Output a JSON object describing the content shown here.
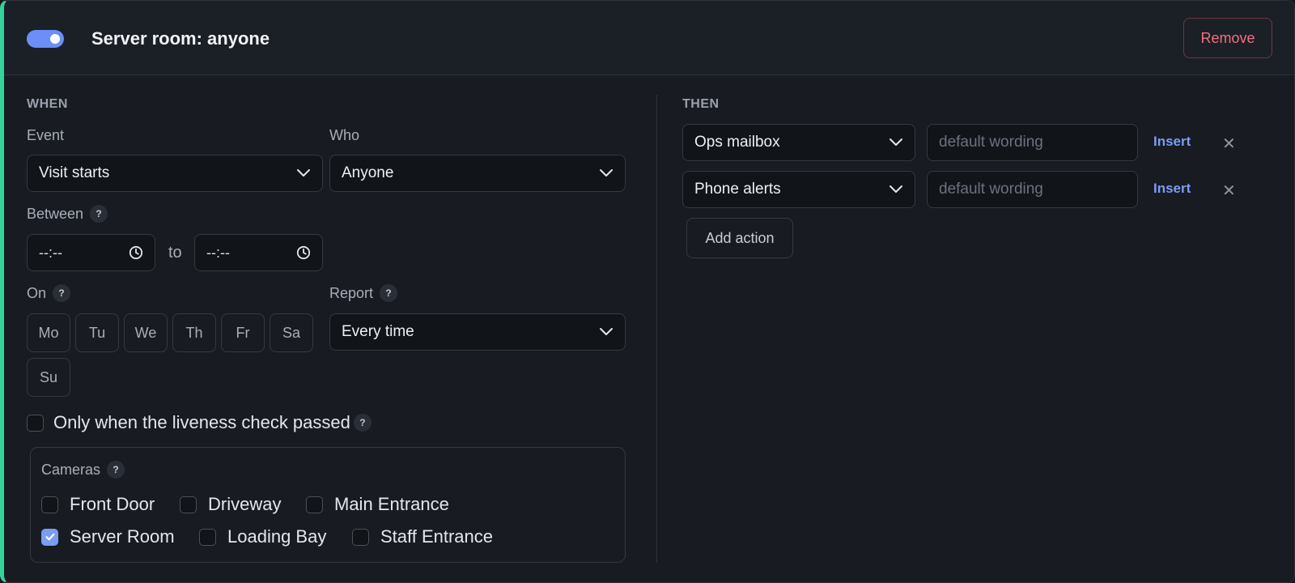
{
  "header": {
    "title": "Server room: anyone",
    "enabled": true,
    "remove_label": "Remove"
  },
  "when": {
    "section_label": "WHEN",
    "event": {
      "label": "Event",
      "value": "Visit starts"
    },
    "who": {
      "label": "Who",
      "value": "Anyone"
    },
    "between": {
      "label": "Between",
      "help": "?",
      "start": "--:--",
      "to": "to",
      "end": "--:--"
    },
    "on": {
      "label": "On",
      "help": "?",
      "days": [
        "Mo",
        "Tu",
        "We",
        "Th",
        "Fr",
        "Sa",
        "Su"
      ]
    },
    "report": {
      "label": "Report",
      "help": "?",
      "value": "Every time"
    },
    "liveness": {
      "label": "Only when the liveness check passed",
      "help": "?",
      "checked": false
    },
    "cameras": {
      "label": "Cameras",
      "help": "?",
      "items": [
        {
          "name": "Front Door",
          "checked": false
        },
        {
          "name": "Driveway",
          "checked": false
        },
        {
          "name": "Main Entrance",
          "checked": false
        },
        {
          "name": "Server Room",
          "checked": true
        },
        {
          "name": "Loading Bay",
          "checked": false
        },
        {
          "name": "Staff Entrance",
          "checked": false
        }
      ]
    }
  },
  "then": {
    "section_label": "THEN",
    "actions": [
      {
        "target": "Ops mailbox",
        "wording_placeholder": "default wording",
        "insert_label": "Insert",
        "remove_glyph": "✕"
      },
      {
        "target": "Phone alerts",
        "wording_placeholder": "default wording",
        "insert_label": "Insert",
        "remove_glyph": "✕"
      }
    ],
    "add_action_label": "Add action"
  },
  "colors": {
    "accent": "#6b8ef7",
    "active_border": "#34d399",
    "danger": "#f07080",
    "link": "#7b9cf5"
  },
  "icons": {
    "dropdown": "chevron-down-icon",
    "time": "clock-icon",
    "remove": "close-icon",
    "checked": "check-icon"
  }
}
